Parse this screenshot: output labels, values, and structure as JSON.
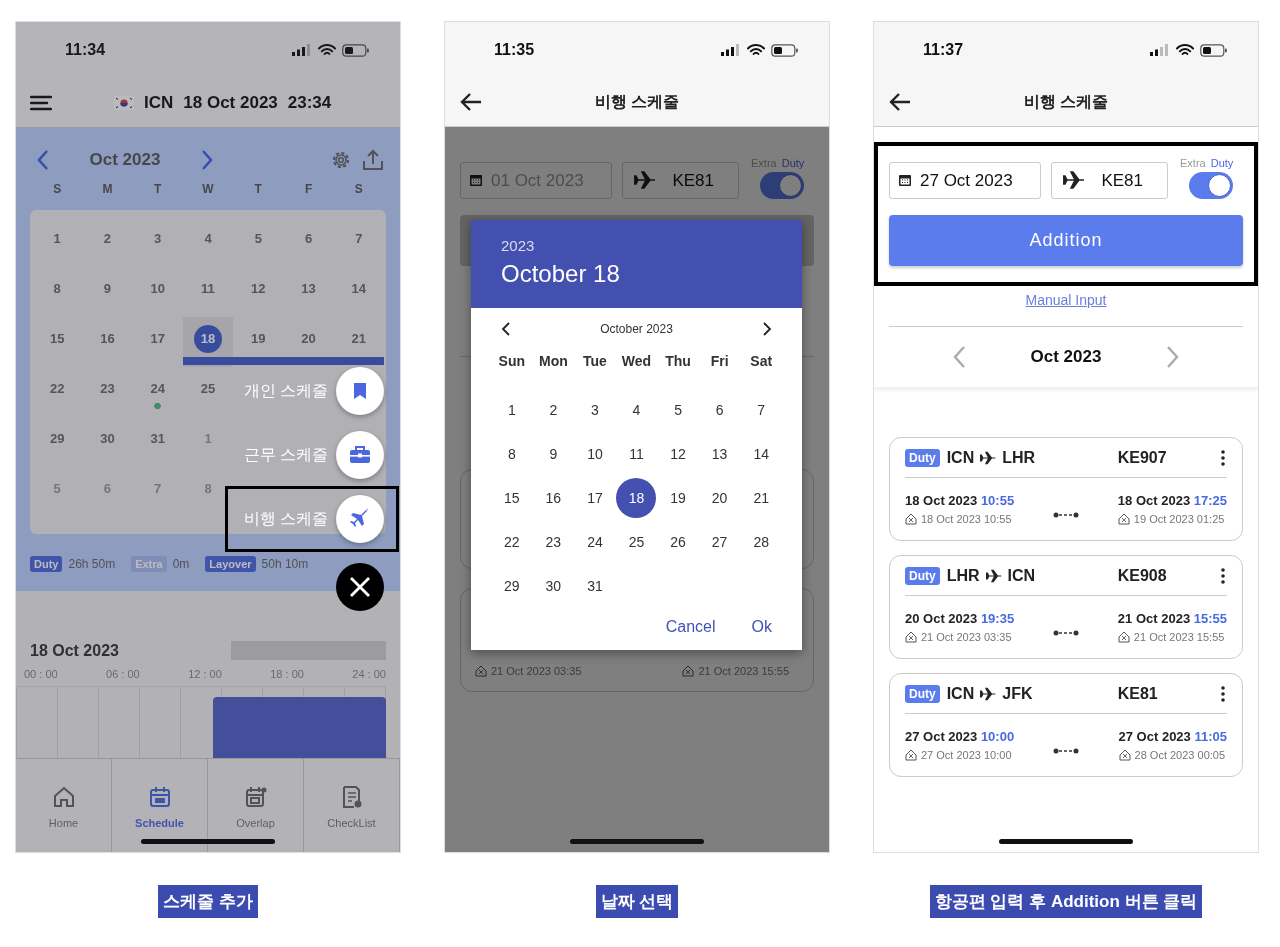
{
  "schedule_screen": {
    "status_bar": {
      "time": "11:34"
    },
    "header": {
      "airport": "ICN",
      "date": "18 Oct 2023",
      "time": "23:34"
    },
    "calendar": {
      "month": "Oct 2023",
      "weekdays": [
        "S",
        "M",
        "T",
        "W",
        "T",
        "F",
        "S"
      ],
      "weeks": [
        {
          "days": [
            {
              "d": "1",
              "selected": false,
              "other_month": false,
              "in_event": false,
              "dot": false
            },
            {
              "d": "2",
              "selected": false,
              "other_month": false,
              "in_event": false,
              "dot": false
            },
            {
              "d": "3",
              "selected": false,
              "other_month": false,
              "in_event": false,
              "dot": false
            },
            {
              "d": "4",
              "selected": false,
              "other_month": false,
              "in_event": false,
              "dot": false
            },
            {
              "d": "5",
              "selected": false,
              "other_month": false,
              "in_event": false,
              "dot": false
            },
            {
              "d": "6",
              "selected": false,
              "other_month": false,
              "in_event": false,
              "dot": false
            },
            {
              "d": "7",
              "selected": false,
              "other_month": false,
              "in_event": false,
              "dot": false
            }
          ]
        },
        {
          "days": [
            {
              "d": "8",
              "selected": false,
              "other_month": false,
              "in_event": false,
              "dot": false
            },
            {
              "d": "9",
              "selected": false,
              "other_month": false,
              "in_event": false,
              "dot": false
            },
            {
              "d": "10",
              "selected": false,
              "other_month": false,
              "in_event": false,
              "dot": false
            },
            {
              "d": "11",
              "selected": false,
              "other_month": false,
              "in_event": false,
              "dot": false
            },
            {
              "d": "12",
              "selected": false,
              "other_month": false,
              "in_event": false,
              "dot": false
            },
            {
              "d": "13",
              "selected": false,
              "other_month": false,
              "in_event": false,
              "dot": false
            },
            {
              "d": "14",
              "selected": false,
              "other_month": false,
              "in_event": false,
              "dot": false
            }
          ]
        },
        {
          "days": [
            {
              "d": "15",
              "selected": false,
              "other_month": false,
              "in_event": false,
              "dot": false
            },
            {
              "d": "16",
              "selected": false,
              "other_month": false,
              "in_event": false,
              "dot": false
            },
            {
              "d": "17",
              "selected": false,
              "other_month": false,
              "in_event": false,
              "dot": false
            },
            {
              "d": "18",
              "selected": true,
              "other_month": false,
              "in_event": true,
              "dot": false
            },
            {
              "d": "19",
              "selected": false,
              "other_month": false,
              "in_event": true,
              "dot": false
            },
            {
              "d": "20",
              "selected": false,
              "other_month": false,
              "in_event": true,
              "dot": false
            },
            {
              "d": "21",
              "selected": false,
              "other_month": false,
              "in_event": true,
              "dot": false
            }
          ]
        },
        {
          "days": [
            {
              "d": "22",
              "selected": false,
              "other_month": false,
              "in_event": false,
              "dot": false
            },
            {
              "d": "23",
              "selected": false,
              "other_month": false,
              "in_event": false,
              "dot": false
            },
            {
              "d": "24",
              "selected": false,
              "other_month": false,
              "in_event": false,
              "dot": true
            },
            {
              "d": "25",
              "selected": false,
              "other_month": false,
              "in_event": false,
              "dot": false
            }
          ]
        },
        {
          "days": [
            {
              "d": "29",
              "selected": false,
              "other_month": false,
              "in_event": false,
              "dot": false
            },
            {
              "d": "30",
              "selected": false,
              "other_month": false,
              "in_event": false,
              "dot": false
            },
            {
              "d": "31",
              "selected": false,
              "other_month": false,
              "in_event": false,
              "dot": false
            },
            {
              "d": "1",
              "selected": false,
              "other_month": true,
              "in_event": false,
              "dot": false
            }
          ]
        },
        {
          "days": [
            {
              "d": "5",
              "selected": false,
              "other_month": true,
              "in_event": false,
              "dot": false
            },
            {
              "d": "6",
              "selected": false,
              "other_month": true,
              "in_event": false,
              "dot": false
            },
            {
              "d": "7",
              "selected": false,
              "other_month": true,
              "in_event": false,
              "dot": false
            },
            {
              "d": "8",
              "selected": false,
              "other_month": true,
              "in_event": false,
              "dot": false
            }
          ]
        }
      ]
    },
    "legend": [
      {
        "label": "Duty",
        "value": "26h 50m",
        "active": true
      },
      {
        "label": "Extra",
        "value": "0m",
        "active": false
      },
      {
        "label": "Layover",
        "value": "50h 10m",
        "active": true
      }
    ],
    "timeline": {
      "date": "18 Oct 2023",
      "ticks": [
        "00 : 00",
        "06 : 00",
        "12 : 00",
        "18 : 00",
        "24 : 00"
      ]
    },
    "tab_bar": [
      {
        "label": "Home",
        "selected": false
      },
      {
        "label": "Schedule",
        "selected": true
      },
      {
        "label": "Overlap",
        "selected": false
      },
      {
        "label": "CheckList",
        "selected": false
      }
    ],
    "fab_menu": {
      "items": [
        {
          "label": "개인 스케줄",
          "highlighted": false
        },
        {
          "label": "근무 스케줄",
          "highlighted": false
        },
        {
          "label": "비행 스케줄",
          "highlighted": true
        }
      ]
    }
  },
  "date_picker_screen": {
    "status_bar": {
      "time": "11:35"
    },
    "header": {
      "title": "비행 스케줄"
    },
    "form": {
      "date_field": {
        "placeholder": "01 Oct 2023"
      },
      "flight_field": {
        "value": "KE81"
      },
      "toggle": {
        "labels": [
          "Extra",
          "Duty"
        ],
        "on": true
      },
      "highlighted": false
    },
    "background_card": {
      "dep_home": "21 Oct 2023 03:35",
      "arr_home": "21 Oct 2023 15:55"
    },
    "dialog": {
      "year": "2023",
      "title": "October 18",
      "month": "October 2023",
      "weekdays": [
        "Sun",
        "Mon",
        "Tue",
        "Wed",
        "Thu",
        "Fri",
        "Sat"
      ],
      "weeks": [
        [
          {
            "d": "1",
            "selected": false
          },
          {
            "d": "2",
            "selected": false
          },
          {
            "d": "3",
            "selected": false
          },
          {
            "d": "4",
            "selected": false
          },
          {
            "d": "5",
            "selected": false
          },
          {
            "d": "6",
            "selected": false
          },
          {
            "d": "7",
            "selected": false
          }
        ],
        [
          {
            "d": "8",
            "selected": false
          },
          {
            "d": "9",
            "selected": false
          },
          {
            "d": "10",
            "selected": false
          },
          {
            "d": "11",
            "selected": false
          },
          {
            "d": "12",
            "selected": false
          },
          {
            "d": "13",
            "selected": false
          },
          {
            "d": "14",
            "selected": false
          }
        ],
        [
          {
            "d": "15",
            "selected": false
          },
          {
            "d": "16",
            "selected": false
          },
          {
            "d": "17",
            "selected": false
          },
          {
            "d": "18",
            "selected": true
          },
          {
            "d": "19",
            "selected": false
          },
          {
            "d": "20",
            "selected": false
          },
          {
            "d": "21",
            "selected": false
          }
        ],
        [
          {
            "d": "22",
            "selected": false
          },
          {
            "d": "23",
            "selected": false
          },
          {
            "d": "24",
            "selected": false
          },
          {
            "d": "25",
            "selected": false
          },
          {
            "d": "26",
            "selected": false
          },
          {
            "d": "27",
            "selected": false
          },
          {
            "d": "28",
            "selected": false
          }
        ],
        [
          {
            "d": "29",
            "selected": false
          },
          {
            "d": "30",
            "selected": false
          },
          {
            "d": "31",
            "selected": false
          }
        ]
      ],
      "buttons": [
        "Cancel",
        "Ok"
      ]
    }
  },
  "flight_list_screen": {
    "status_bar": {
      "time": "11:37"
    },
    "header": {
      "title": "비행 스케줄"
    },
    "form": {
      "date_field": {
        "value": "27 Oct 2023"
      },
      "flight_field": {
        "value": "KE81"
      },
      "toggle": {
        "labels": [
          "Extra",
          "Duty"
        ],
        "on": true
      },
      "highlighted": true
    },
    "add_button": "Addition",
    "manual_link": "Manual Input",
    "month": "Oct 2023",
    "flights": [
      {
        "tag": "Duty",
        "from": "ICN",
        "to": "LHR",
        "flight": "KE907",
        "dep_date": "18 Oct 2023",
        "dep_time": "10:55",
        "dep_home": "18 Oct 2023 10:55",
        "arr_date": "18 Oct 2023",
        "arr_time": "17:25",
        "arr_home": "19 Oct 2023 01:25"
      },
      {
        "tag": "Duty",
        "from": "LHR",
        "to": "ICN",
        "flight": "KE908",
        "dep_date": "20 Oct 2023",
        "dep_time": "19:35",
        "dep_home": "21 Oct 2023 03:35",
        "arr_date": "21 Oct 2023",
        "arr_time": "15:55",
        "arr_home": "21 Oct 2023 15:55"
      },
      {
        "tag": "Duty",
        "from": "ICN",
        "to": "JFK",
        "flight": "KE81",
        "dep_date": "27 Oct 2023",
        "dep_time": "10:00",
        "dep_home": "27 Oct 2023 10:00",
        "arr_date": "27 Oct 2023",
        "arr_time": "11:05",
        "arr_home": "28 Oct 2023 00:05"
      }
    ]
  },
  "captions": [
    "스케줄 추가",
    "날짜 선택",
    "항공편 입력 후 Addition 버튼 클릭"
  ]
}
